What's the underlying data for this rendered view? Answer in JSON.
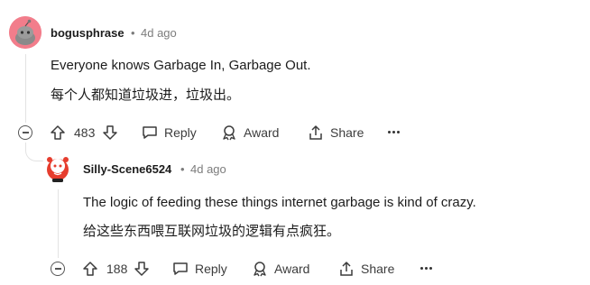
{
  "comments": [
    {
      "username": "bogusphrase",
      "separator": "•",
      "time": "4d ago",
      "text_en": "Everyone knows Garbage In, Garbage Out.",
      "text_zh": "每个人都知道垃圾进，垃圾出。",
      "votes": "483",
      "reply_label": "Reply",
      "award_label": "Award",
      "share_label": "Share"
    },
    {
      "username": "Silly-Scene6524",
      "separator": "•",
      "time": "4d ago",
      "text_en": "The logic of feeding these things internet garbage is kind of crazy.",
      "text_zh": "给这些东西喂互联网垃圾的逻辑有点疯狂。",
      "votes": "188",
      "reply_label": "Reply",
      "award_label": "Award",
      "share_label": "Share"
    }
  ],
  "colors": {
    "avatar1_bg": "#f27d8b",
    "avatar2_bg": "#e63d2e",
    "meta": "#7c7c7c",
    "rail": "#e3e3e3"
  }
}
